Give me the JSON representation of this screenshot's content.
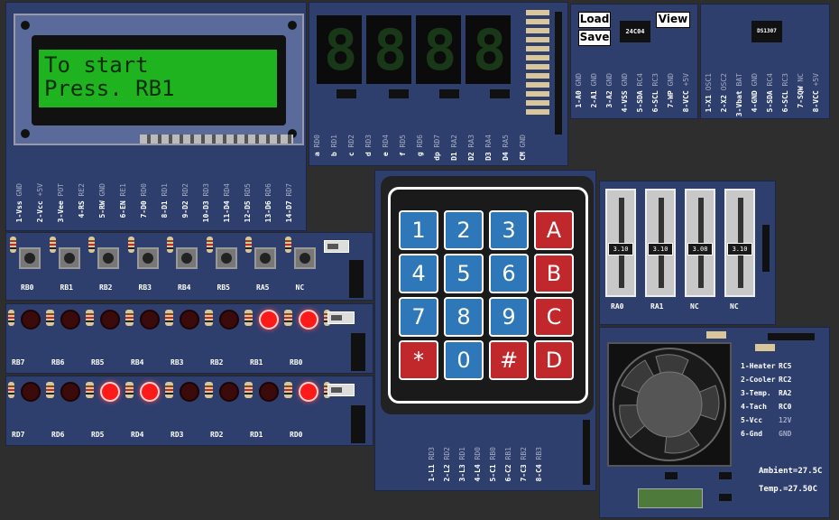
{
  "lcd": {
    "line1": "To start",
    "line2": "Press. RB1",
    "pins": [
      {
        "label": "1-Vss",
        "val": "GND"
      },
      {
        "label": "2-Vcc",
        "val": "+5V"
      },
      {
        "label": "3-Vee",
        "val": "POT"
      },
      {
        "label": "4-RS",
        "val": "RE2"
      },
      {
        "label": "5-RW",
        "val": "GND"
      },
      {
        "label": "6-EN",
        "val": "RE1"
      },
      {
        "label": "7-D0",
        "val": "RD0"
      },
      {
        "label": "8-D1",
        "val": "RD1"
      },
      {
        "label": "9-D2",
        "val": "RD2"
      },
      {
        "label": "10-D3",
        "val": "RD3"
      },
      {
        "label": "11-D4",
        "val": "RD4"
      },
      {
        "label": "12-D5",
        "val": "RD5"
      },
      {
        "label": "13-D6",
        "val": "RD6"
      },
      {
        "label": "14-D7",
        "val": "RD7"
      }
    ]
  },
  "seven_seg": {
    "digits": [
      "8",
      "8",
      "8",
      "8"
    ],
    "pins": [
      {
        "label": "a",
        "val": "RD0"
      },
      {
        "label": "b",
        "val": "RD1"
      },
      {
        "label": "c",
        "val": "RD2"
      },
      {
        "label": "d",
        "val": "RD3"
      },
      {
        "label": "e",
        "val": "RD4"
      },
      {
        "label": "f",
        "val": "RD5"
      },
      {
        "label": "g",
        "val": "RD6"
      },
      {
        "label": "dp",
        "val": "RD7"
      },
      {
        "label": "D1",
        "val": "RA2"
      },
      {
        "label": "D2",
        "val": "RA3"
      },
      {
        "label": "D3",
        "val": "RA4"
      },
      {
        "label": "D4",
        "val": "RA5"
      },
      {
        "label": "CM",
        "val": "GND"
      }
    ]
  },
  "eeprom": {
    "load": "Load",
    "save": "Save",
    "view": "View",
    "chip": "24C04",
    "pins": [
      {
        "label": "1-A0",
        "val": "GND"
      },
      {
        "label": "2-A1",
        "val": "GND"
      },
      {
        "label": "3-A2",
        "val": "GND"
      },
      {
        "label": "4-VSS",
        "val": "GND"
      },
      {
        "label": "5-SDA",
        "val": "RC4"
      },
      {
        "label": "6-SCL",
        "val": "RC3"
      },
      {
        "label": "7-WP",
        "val": "GND"
      },
      {
        "label": "8-VCC",
        "val": "+5V"
      }
    ]
  },
  "rtc": {
    "chip": "DS1307",
    "pins": [
      {
        "label": "1-X1",
        "val": "OSC1"
      },
      {
        "label": "2-X2",
        "val": "OSC2"
      },
      {
        "label": "3-Vbat",
        "val": "BAT"
      },
      {
        "label": "4-GND",
        "val": "GND"
      },
      {
        "label": "5-SDA",
        "val": "RC4"
      },
      {
        "label": "6-SCL",
        "val": "RC3"
      },
      {
        "label": "7-SQW",
        "val": "NC"
      },
      {
        "label": "8-VCC",
        "val": "+5V"
      }
    ]
  },
  "buttons": [
    "RB0",
    "RB1",
    "RB2",
    "RB3",
    "RB4",
    "RB5",
    "RA5",
    "NC"
  ],
  "leds_b": {
    "labels": [
      "RB7",
      "RB6",
      "RB5",
      "RB4",
      "RB3",
      "RB2",
      "RB1",
      "RB0"
    ],
    "on": [
      false,
      false,
      false,
      false,
      false,
      false,
      true,
      true
    ]
  },
  "leds_d": {
    "labels": [
      "RD7",
      "RD6",
      "RD5",
      "RD4",
      "RD3",
      "RD2",
      "RD1",
      "RD0"
    ],
    "on": [
      false,
      false,
      true,
      true,
      false,
      false,
      false,
      true
    ]
  },
  "keypad": {
    "keys": [
      {
        "k": "1",
        "c": "b"
      },
      {
        "k": "2",
        "c": "b"
      },
      {
        "k": "3",
        "c": "b"
      },
      {
        "k": "A",
        "c": "r"
      },
      {
        "k": "4",
        "c": "b"
      },
      {
        "k": "5",
        "c": "b"
      },
      {
        "k": "6",
        "c": "b"
      },
      {
        "k": "B",
        "c": "r"
      },
      {
        "k": "7",
        "c": "b"
      },
      {
        "k": "8",
        "c": "b"
      },
      {
        "k": "9",
        "c": "b"
      },
      {
        "k": "C",
        "c": "r"
      },
      {
        "k": "*",
        "c": "r"
      },
      {
        "k": "0",
        "c": "b"
      },
      {
        "k": "#",
        "c": "r"
      },
      {
        "k": "D",
        "c": "r"
      }
    ],
    "pins": [
      {
        "label": "1-L1",
        "val": "RD3"
      },
      {
        "label": "2-L2",
        "val": "RD2"
      },
      {
        "label": "3-L3",
        "val": "RD1"
      },
      {
        "label": "4-L4",
        "val": "RD0"
      },
      {
        "label": "5-C1",
        "val": "RB0"
      },
      {
        "label": "6-C2",
        "val": "RB1"
      },
      {
        "label": "7-C3",
        "val": "RB2"
      },
      {
        "label": "8-C4",
        "val": "RB3"
      }
    ]
  },
  "pots": [
    {
      "value": "3.10",
      "label": "RA0",
      "level": 0.42
    },
    {
      "value": "3.10",
      "label": "RA1",
      "level": 0.42
    },
    {
      "value": "3.08",
      "label": "NC",
      "level": 0.42
    },
    {
      "value": "3.10",
      "label": "NC",
      "level": 0.42
    }
  ],
  "heater": {
    "pins": [
      {
        "label": "1-Heater",
        "val": "RC5"
      },
      {
        "label": "2-Cooler",
        "val": "RC2"
      },
      {
        "label": "3-Temp.",
        "val": "RA2"
      },
      {
        "label": "4-Tach",
        "val": "RC0"
      },
      {
        "label": "5-Vcc",
        "val": "12V"
      },
      {
        "label": "6-Gnd",
        "val": "GND"
      }
    ],
    "ambient": "Ambient=27.5C",
    "temp": "Temp.=27.50C"
  },
  "colors": {
    "board": "#2e3f6e",
    "lcd_bg": "#1fb31f",
    "key_blue": "#2e77b8",
    "key_red": "#c0282c",
    "led_on": "#ff1a1a"
  }
}
